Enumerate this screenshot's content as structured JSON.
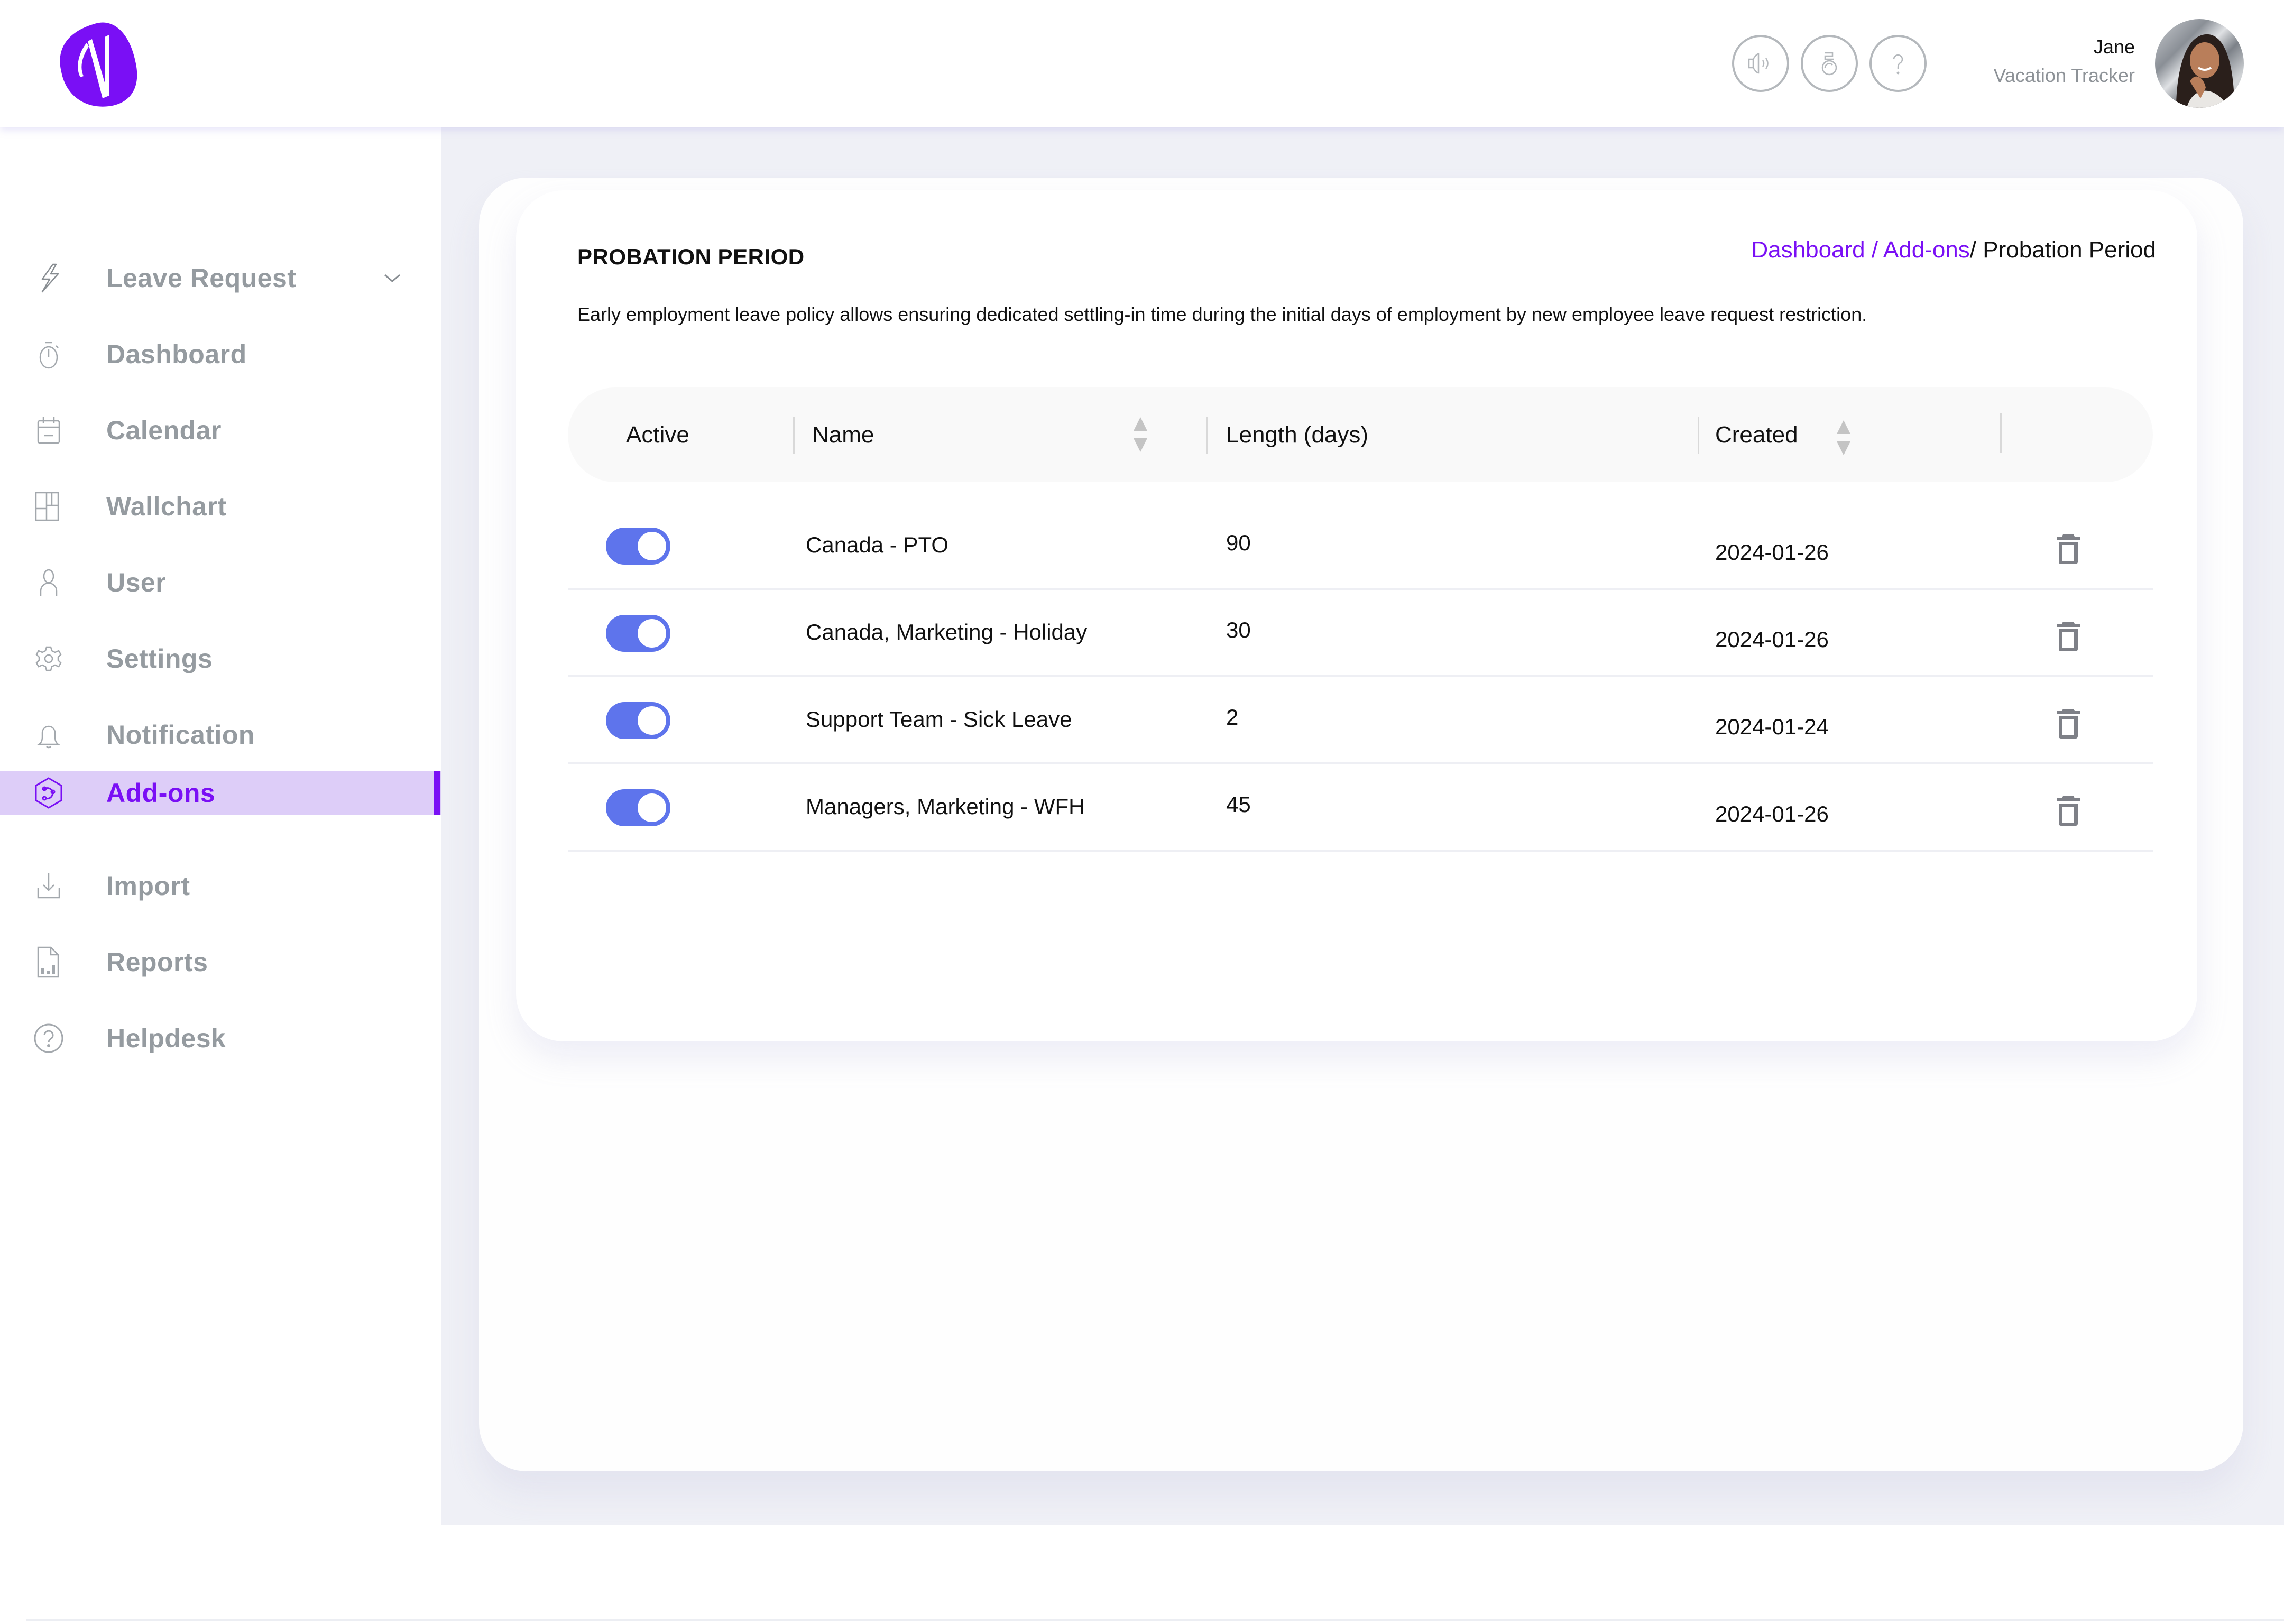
{
  "header": {
    "logo_letter": "V",
    "icons": [
      {
        "name": "announcement-icon",
        "label": "Announcements"
      },
      {
        "name": "gift-icon",
        "label": "Gifts"
      },
      {
        "name": "help-icon",
        "label": "Help"
      }
    ],
    "user": {
      "name": "Jane",
      "organization": "Vacation Tracker"
    }
  },
  "sidebar": {
    "items": [
      {
        "label": "Leave Request",
        "icon": "lightning-icon",
        "has_submenu": true
      },
      {
        "label": "Dashboard",
        "icon": "stopwatch-icon"
      },
      {
        "label": "Calendar",
        "icon": "calendar-icon"
      },
      {
        "label": "Wallchart",
        "icon": "wallchart-icon"
      },
      {
        "label": "User",
        "icon": "user-icon"
      },
      {
        "label": "Settings",
        "icon": "gear-icon"
      },
      {
        "label": "Notification",
        "icon": "bell-icon"
      },
      {
        "label": "Add-ons",
        "icon": "addons-icon",
        "active": true
      },
      {
        "label": "Import",
        "icon": "import-icon"
      },
      {
        "label": "Reports",
        "icon": "report-icon"
      },
      {
        "label": "Helpdesk",
        "icon": "help-circle-icon"
      }
    ]
  },
  "page": {
    "title": "PROBATION PERIOD",
    "breadcrumb": {
      "items": [
        "Dashboard",
        "Add-ons"
      ],
      "separator": " / ",
      "current": "/ Probation Period"
    },
    "description": "Early employment leave policy allows ensuring dedicated settling-in time during the initial days of employment by new employee leave request restriction."
  },
  "table": {
    "columns": [
      {
        "label": "Active",
        "sortable": false
      },
      {
        "label": "Name",
        "sortable": true
      },
      {
        "label": "Length (days)",
        "sortable": false
      },
      {
        "label": "Created",
        "sortable": true
      }
    ],
    "rows": [
      {
        "active": true,
        "name": "Canada - PTO",
        "length": "90",
        "created": "2024-01-26"
      },
      {
        "active": true,
        "name": "Canada, Marketing - Holiday",
        "length": "30",
        "created": "2024-01-26"
      },
      {
        "active": true,
        "name": "Support Team - Sick Leave",
        "length": "2",
        "created": "2024-01-24"
      },
      {
        "active": true,
        "name": "Managers, Marketing - WFH",
        "length": "45",
        "created": "2024-01-26"
      }
    ]
  },
  "colors": {
    "brand": "#7a0ff5",
    "active_nav_bg": "#ddcdf8",
    "toggle_on": "#5e74ec",
    "muted_text": "#959ba0",
    "main_bg": "#eff0f6"
  }
}
